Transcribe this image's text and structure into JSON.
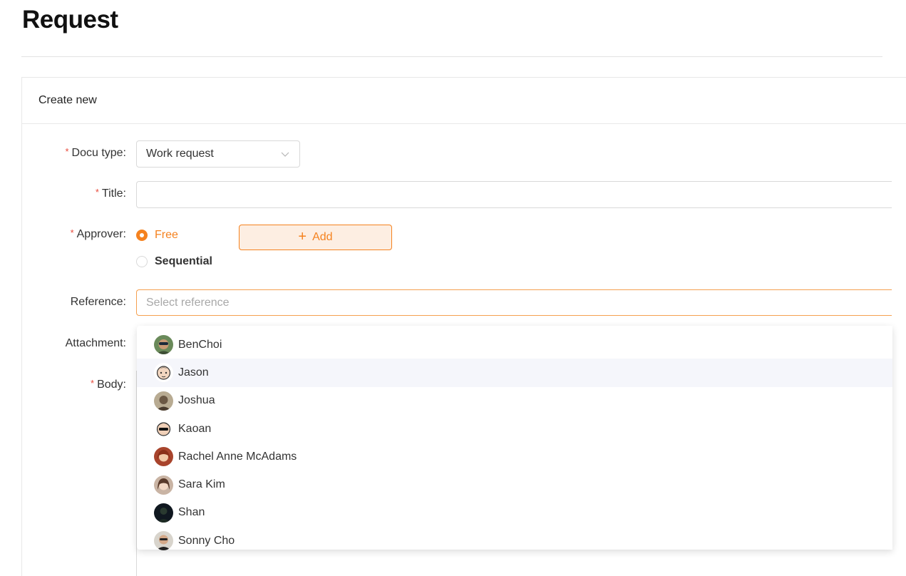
{
  "page": {
    "title": "Request"
  },
  "card": {
    "header": "Create new"
  },
  "form": {
    "docu_type": {
      "label": "Docu type:",
      "value": "Work request"
    },
    "title": {
      "label": "Title:",
      "value": ""
    },
    "approver": {
      "label": "Approver:",
      "options": [
        {
          "label": "Free",
          "selected": true
        },
        {
          "label": "Sequential",
          "selected": false
        }
      ],
      "add_label": "Add"
    },
    "reference": {
      "label": "Reference:",
      "placeholder": "Select reference"
    },
    "attachment": {
      "label": "Attachment:"
    },
    "body": {
      "label": "Body:"
    },
    "required_mark": "*"
  },
  "dropdown": {
    "items": [
      {
        "name": "BenChoi",
        "avatar": "avatar-sunglasses-man"
      },
      {
        "name": "Jason",
        "avatar": "avatar-cartoon-face"
      },
      {
        "name": "Joshua",
        "avatar": "avatar-man-photo"
      },
      {
        "name": "Kaoan",
        "avatar": "avatar-cartoon-sunglasses"
      },
      {
        "name": "Rachel Anne McAdams",
        "avatar": "avatar-woman-red-hair"
      },
      {
        "name": "Sara Kim",
        "avatar": "avatar-woman-photo"
      },
      {
        "name": "Shan",
        "avatar": "avatar-dark-photo"
      },
      {
        "name": "Sonny Cho",
        "avatar": "avatar-man-glasses"
      }
    ],
    "hover_index": 1
  },
  "colors": {
    "accent": "#f5821f",
    "required": "#e84a3b"
  }
}
